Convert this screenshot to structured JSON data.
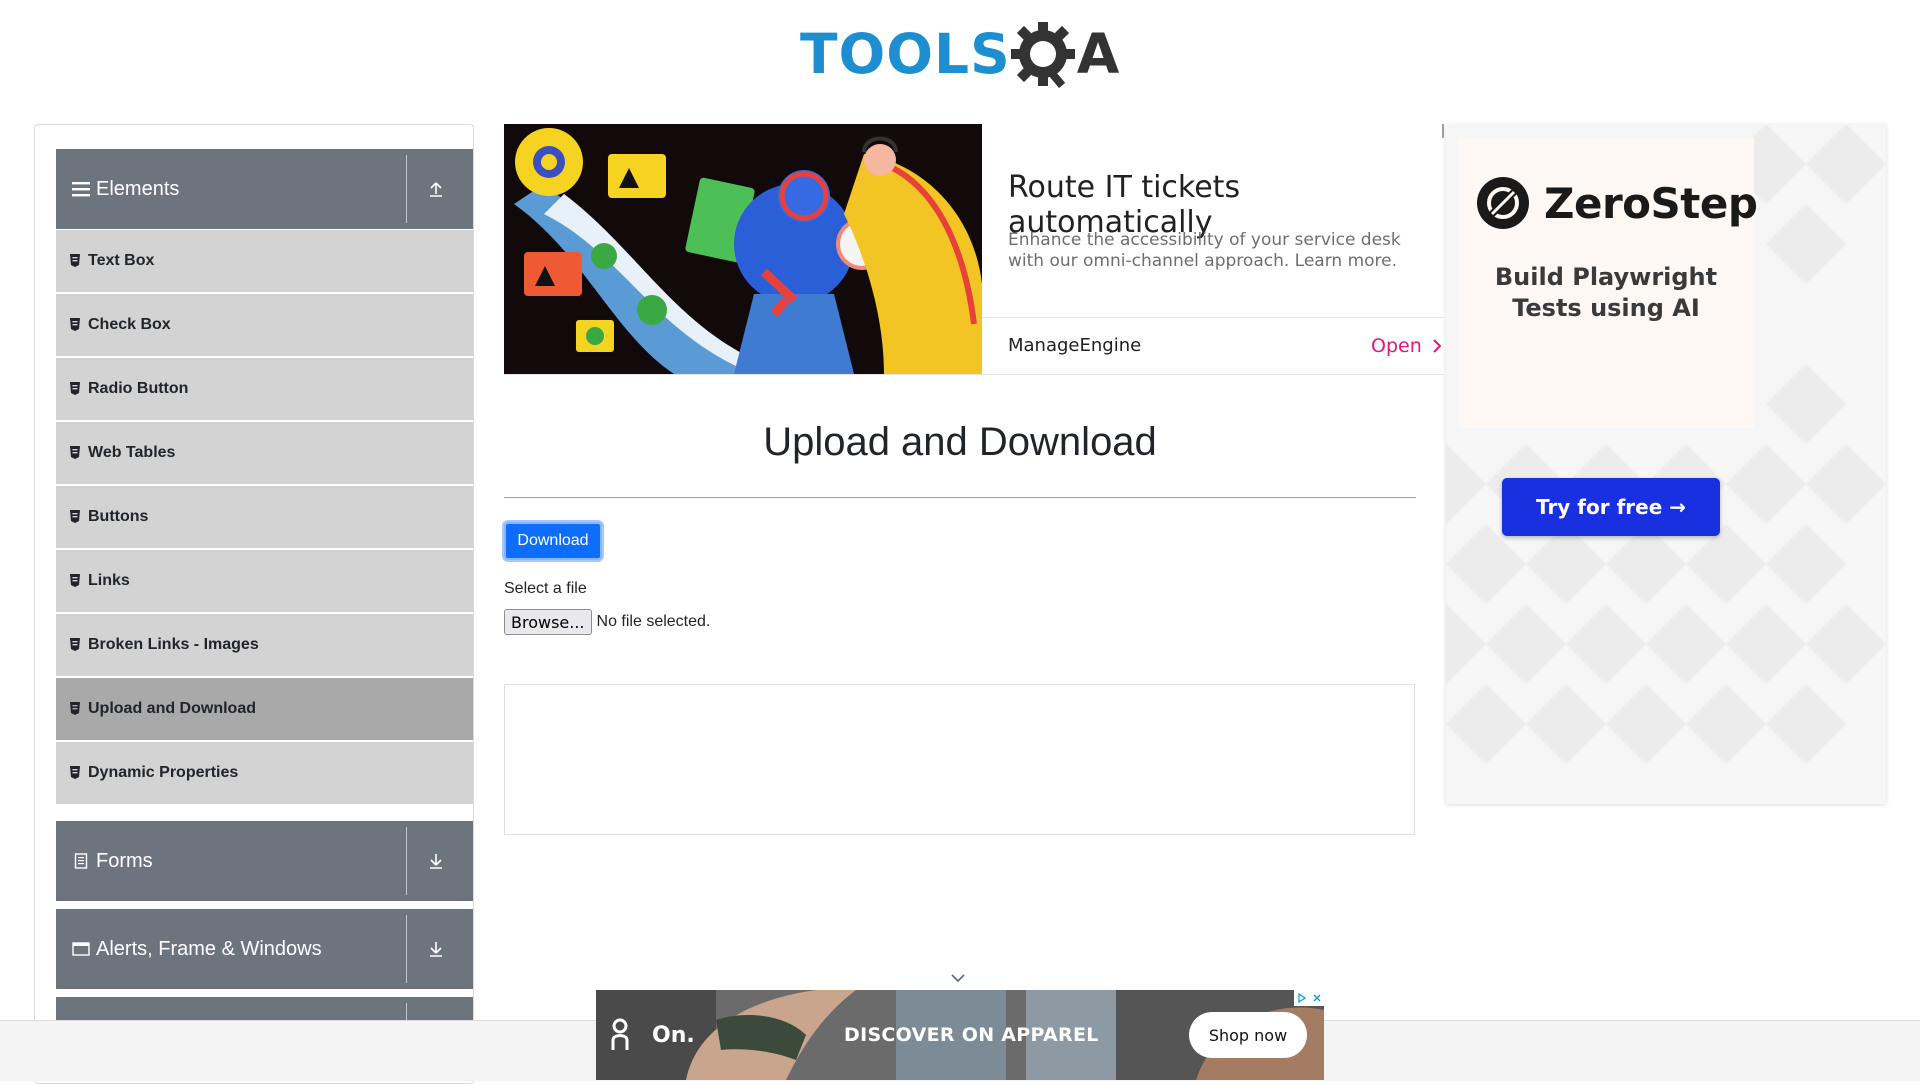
{
  "logo": {
    "text_main": "TOOLS",
    "text_end": "A"
  },
  "sidebar": {
    "groups": [
      {
        "label": "Elements",
        "icon": "hamburger-icon",
        "toggle": "collapse-up-icon"
      },
      {
        "label": "Forms",
        "icon": "document-icon",
        "toggle": "expand-down-icon"
      },
      {
        "label": "Alerts, Frame & Windows",
        "icon": "window-icon",
        "toggle": "expand-down-icon"
      }
    ],
    "items": [
      {
        "label": "Text Box",
        "active": false
      },
      {
        "label": "Check Box",
        "active": false
      },
      {
        "label": "Radio Button",
        "active": false
      },
      {
        "label": "Web Tables",
        "active": false
      },
      {
        "label": "Buttons",
        "active": false
      },
      {
        "label": "Links",
        "active": false
      },
      {
        "label": "Broken Links - Images",
        "active": false
      },
      {
        "label": "Upload and Download",
        "active": true
      },
      {
        "label": "Dynamic Properties",
        "active": false
      }
    ]
  },
  "top_ad": {
    "title": "Route IT tickets automatically",
    "description": "Enhance the accessibility of your service desk with our omni-channel approach. Learn more.",
    "brand": "ManageEngine",
    "cta": "Open"
  },
  "main": {
    "title": "Upload and Download",
    "download_label": "Download",
    "select_label": "Select a file",
    "browse_label": "Browse...",
    "file_status": "No file selected."
  },
  "right_ad": {
    "brand": "ZeroStep",
    "subtitle": "Build Playwright Tests using AI",
    "cta": "Try for free →"
  },
  "bottom_ad": {
    "brand": "On.",
    "headline": "DISCOVER ON APPAREL",
    "cta": "Shop now"
  },
  "colors": {
    "sidebar_header": "#6c757d",
    "menu_item": "#d3d3d3",
    "menu_item_active": "#a9a9a9",
    "primary_button": "#0d6efd",
    "ad_cta_pink": "#e2177a",
    "zerostep_button": "#1930e0",
    "logo_blue": "#1d8ecf"
  }
}
